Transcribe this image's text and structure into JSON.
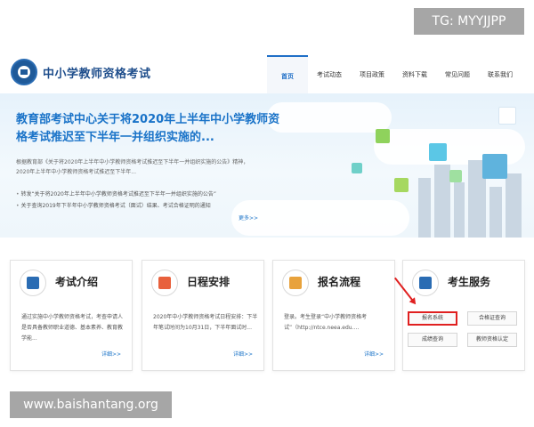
{
  "overlay": {
    "tg_label": "TG: MYYJJPP",
    "site_label": "www.baishantang.org"
  },
  "header": {
    "site_title": "中小学教师资格考试",
    "nav": [
      "首页",
      "考试动态",
      "项目政策",
      "资料下载",
      "常见问题",
      "联系我们"
    ],
    "active_nav": "首页"
  },
  "banner": {
    "headline": "教育部考试中心关于将2020年上半年中小学教师资格考试推迟至下半年一并组织实施的...",
    "summary": "根据教育部《关于将2020年上半年中小学教师资格考试推迟至下半年一并组织实施的公告》精神，2020年上半年中小学教师资格考试推迟至下半年...",
    "bullets": [
      "转发“关于将2020年上半年中小学教师资格考试推迟至下半年一并组织实施的公告”",
      "关于查询2019年下半年中小学教师资格考试（面试）结果、考试合格证明的通知"
    ],
    "more": "更多>>"
  },
  "cards": [
    {
      "title": "考试介绍",
      "body": "通过实施中小学教师资格考试，考查申请人是否具备教师职业道德、基本素养、教育教学能...",
      "more": "详细>>",
      "icon": "document-icon",
      "color": "#2a6cb3"
    },
    {
      "title": "日程安排",
      "body": "2020年中小学教师资格考试日程安排：下半年笔试时间为10月31日，下半年面试时...",
      "more": "详细>>",
      "icon": "checkmark-icon",
      "color": "#e8603c"
    },
    {
      "title": "报名流程",
      "body": "登录。考生登录“中小学教师资格考试”（http://ntce.neea.edu....",
      "more": "详细>>",
      "icon": "form-icon",
      "color": "#e8a23c"
    },
    {
      "title": "考生服务",
      "icon": "id-card-icon",
      "color": "#2a6cb3",
      "buttons": [
        "报名系统",
        "合格证查询",
        "成绩查询",
        "教师资格认定"
      ]
    }
  ],
  "colors": {
    "accent": "#1a73c8",
    "highlight": "#e02020"
  }
}
